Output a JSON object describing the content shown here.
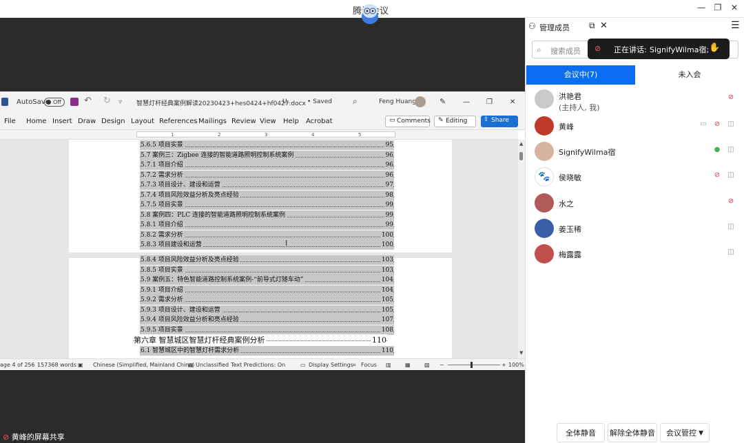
{
  "app": {
    "title": "腾讯会议",
    "minimize": "—",
    "restore": "❐",
    "close": "✕"
  },
  "word": {
    "autosave": "AutoSave",
    "autosave_state": "Off",
    "filename": "智慧灯杆经典案例解读20230423+hes0424+hf0427.docx",
    "sensitivity": "U...",
    "saved": "• Saved",
    "user": "Feng Huang",
    "menu": [
      "File",
      "Home",
      "Insert",
      "Draw",
      "Design",
      "Layout",
      "References",
      "Mailings",
      "Review",
      "View",
      "Help",
      "Acrobat"
    ],
    "comments": "Comments",
    "editing": "Editing",
    "share": "Share",
    "ruler_ticks": [
      "1",
      "2",
      "3",
      "4",
      "5"
    ],
    "toc": [
      {
        "t": "5.6.5  项目实景",
        "p": "95"
      },
      {
        "t": "5.7  案例三：Zigbee 连接的智能道路照明控制系统案例",
        "p": "96"
      },
      {
        "t": "5.7.1  项目介绍",
        "p": "96"
      },
      {
        "t": "5.7.2  需求分析",
        "p": "96"
      },
      {
        "t": "5.7.3  项目设计、建设和运营",
        "p": "97"
      },
      {
        "t": "5.7.4  项目风险效益分析及亮点经验",
        "p": "98"
      },
      {
        "t": "5.7.5  项目实景",
        "p": "99"
      },
      {
        "t": "5.8  案例四：PLC 连接的智能道路照明控制系统案例",
        "p": "99"
      },
      {
        "t": "5.8.1  项目介绍",
        "p": "99"
      },
      {
        "t": "5.8.2  需求分析",
        "p": "100"
      },
      {
        "t": "5.8.3  项目建设和运营",
        "p": "100"
      },
      {
        "t": "5.8.4  项目风险效益分析及亮点经验",
        "p": "103"
      },
      {
        "t": "5.8.5  项目实景",
        "p": "103"
      },
      {
        "t": "5.9  案例五：特色智能道路控制系统案例-“前导式灯随车动”",
        "p": "104"
      },
      {
        "t": "5.9.1  项目介绍",
        "p": "104"
      },
      {
        "t": "5.9.2  需求分析",
        "p": "105"
      },
      {
        "t": "5.9.3  项目设计、建设和运营",
        "p": "105"
      },
      {
        "t": "5.9.4  项目风险效益分析和亮点经验",
        "p": "107"
      },
      {
        "t": "5.9.5  项目实景",
        "p": "108"
      },
      {
        "t": "第六章  智慧城区智慧灯杆经典案例分析",
        "p": "110"
      },
      {
        "t": "6.1  智慧城区中的智慧灯杆需求分析",
        "p": "110"
      }
    ],
    "status": {
      "page": "age 4 of 256",
      "words": "157368 words",
      "lang": "Chinese (Simplified, Mainland China)",
      "class": "Unclassified",
      "pred": "Text Predictions: On",
      "display": "Display Settings",
      "focus": "Focus",
      "zoom": "100%"
    }
  },
  "panel": {
    "title": "管理成员",
    "search_placeholder": "搜索成员",
    "speaking_label": "正在讲话:",
    "speaking_name": "SignifyWilma宿;",
    "tab_in": "会议中(7)",
    "tab_out": "未入会",
    "members": [
      {
        "name": "洪艳君",
        "sub": "(主持人, 我)",
        "color": "#c9c9c9"
      },
      {
        "name": "黄峰",
        "sub": "",
        "color": "#c0392b"
      },
      {
        "name": "SignifyWilma宿",
        "sub": "",
        "color": "#d7b49e"
      },
      {
        "name": "侯晓敏",
        "sub": "",
        "color": "#ffffff"
      },
      {
        "name": "水之",
        "sub": "",
        "color": "#b05a5a"
      },
      {
        "name": "姜玉稀",
        "sub": "",
        "color": "#3a5ea8"
      },
      {
        "name": "梅露露",
        "sub": "",
        "color": "#c0504d"
      }
    ],
    "mute_all": "全体静音",
    "unmute_all": "解除全体静音",
    "control": "会议管控"
  },
  "share_label": "黄峰的屏幕共享"
}
